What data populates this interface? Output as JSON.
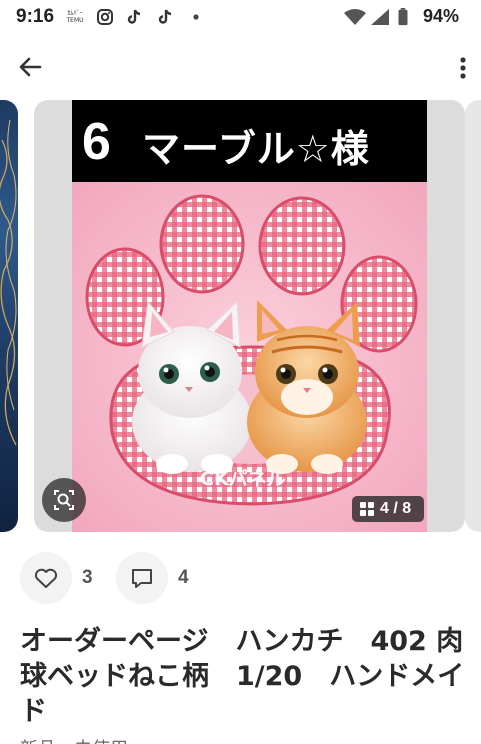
{
  "status_bar": {
    "time": "9:16",
    "temu_label_top": "ｶﾑﾊﾞｰ",
    "temu_label_bottom": "TEMU",
    "battery_pct": "94%",
    "icons": [
      "temu-icon",
      "instagram-icon",
      "tiktok-icon",
      "tiktok-icon",
      "dot-icon",
      "wifi-icon",
      "signal-icon",
      "battery-icon"
    ]
  },
  "top_bar": {
    "back_icon": "arrow-left-icon",
    "more_icon": "more-vertical-icon"
  },
  "image": {
    "header_number": "6",
    "header_text": "マーブル☆様",
    "watermark": "CKパネル",
    "counter": "4 / 8"
  },
  "actions": {
    "likes": "3",
    "comments": "4"
  },
  "product": {
    "title": "オーダーページ　ハンカチ　402 肉球ベッドねこ柄　1/20　ハンドメイド",
    "condition": "新品、未使用"
  }
}
